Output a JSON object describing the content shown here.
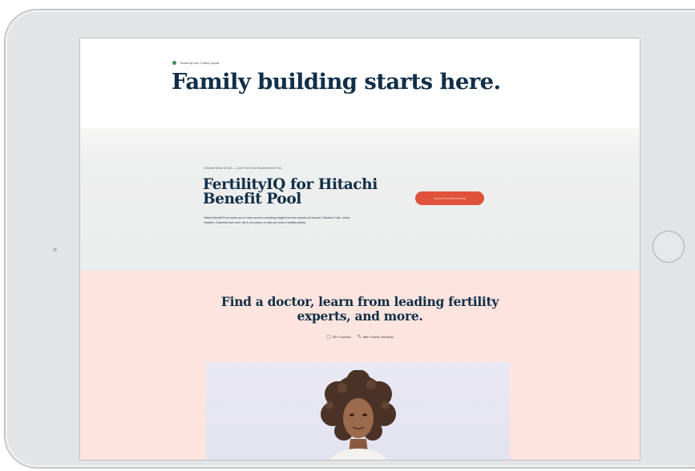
{
  "hero": {
    "trusted_text": "Trusted by over 1 million people",
    "title": "Family building starts here."
  },
  "benefit": {
    "eyebrow": "A Benefit Worth $2,000 — Now Free From Hitachi Benefit Pool",
    "title_line1": "FertilityIQ for Hitachi",
    "title_line2": "Benefit Pool",
    "description": "Hitachi Benefit Pool wants you to have access to leading insight from the experts at Harvard, Stanford, Yale, Johns Hopkins, Columbia and more. All in one place, to help you build a healthy family.",
    "cta_label": "Unlock Free Membership"
  },
  "find": {
    "title_line1": "Find a doctor, learn from leading fertility",
    "title_line2": "experts, and more.",
    "stats": [
      {
        "icon": "monitor-icon",
        "label": "55+ Courses"
      },
      {
        "icon": "review-icon",
        "label": "56k+ Doctor Reviews"
      }
    ]
  },
  "colors": {
    "navy": "#112f48",
    "cta": "#e0523a",
    "peach": "#fde4de",
    "gray_band": "#eceded",
    "device": "#e3e4e6"
  }
}
